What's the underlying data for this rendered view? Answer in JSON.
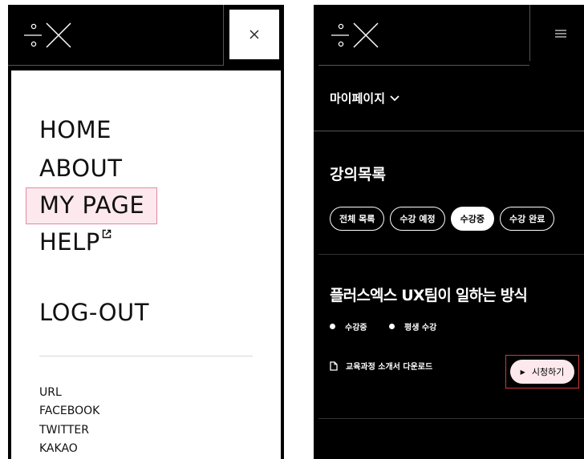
{
  "left_panel": {
    "logo": "plus-x-logo",
    "close_icon": "close-icon",
    "nav": {
      "home": "HOME",
      "about": "ABOUT",
      "my_page": "MY PAGE",
      "help": "HELP",
      "help_icon": "external-link-icon",
      "logout": "LOG-OUT"
    },
    "social": [
      "URL",
      "FACEBOOK",
      "TWITTER",
      "KAKAO"
    ],
    "highlight_color": "#fde9ed",
    "highlight_border": "#e58a9e"
  },
  "right_panel": {
    "logo": "plus-x-logo",
    "menu_icon": "hamburger-icon",
    "mypage_dropdown": "마이페이지",
    "section_title": "강의목록",
    "filters": [
      {
        "label": "전체 목록",
        "active": false
      },
      {
        "label": "수강 예정",
        "active": false
      },
      {
        "label": "수강중",
        "active": true
      },
      {
        "label": "수강 완료",
        "active": false
      }
    ],
    "course": {
      "title": "플러스엑스 UX팀이 일하는 방식",
      "status": [
        "수강중",
        "평생 수강"
      ],
      "download_label": "교육과정 소개서 다운로드",
      "watch_label": "시청하기",
      "watch_icon": "play-icon"
    },
    "highlight_border": "#d23a3a"
  }
}
